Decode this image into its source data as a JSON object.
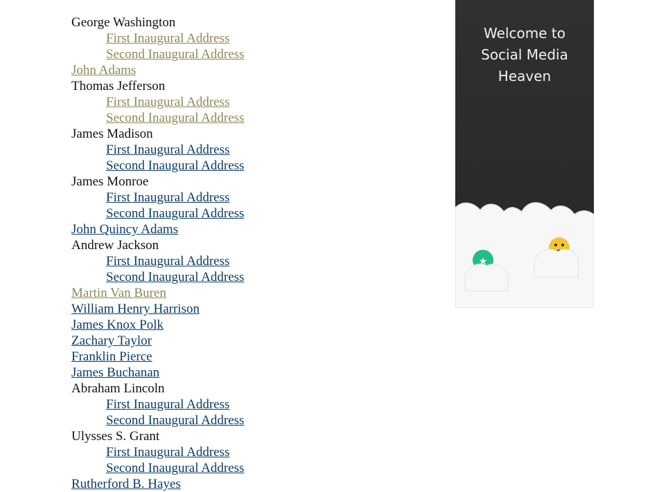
{
  "presidents": [
    {
      "name": "George Washington",
      "link": false,
      "visited": false,
      "addresses": [
        {
          "label": "First Inaugural Address",
          "visited": true
        },
        {
          "label": "Second Inaugural Address",
          "visited": true
        }
      ]
    },
    {
      "name": "John Adams",
      "link": true,
      "visited": true,
      "addresses": []
    },
    {
      "name": "Thomas Jefferson",
      "link": false,
      "visited": false,
      "addresses": [
        {
          "label": "First Inaugural Address",
          "visited": true
        },
        {
          "label": "Second Inaugural Address",
          "visited": true
        }
      ]
    },
    {
      "name": "James Madison",
      "link": false,
      "visited": false,
      "addresses": [
        {
          "label": "First Inaugural Address",
          "visited": false
        },
        {
          "label": "Second Inaugural Address",
          "visited": false
        }
      ]
    },
    {
      "name": "James Monroe",
      "link": false,
      "visited": false,
      "addresses": [
        {
          "label": "First Inaugural Address",
          "visited": false
        },
        {
          "label": "Second Inaugural Address",
          "visited": false
        }
      ]
    },
    {
      "name": "John Quincy Adams",
      "link": true,
      "visited": false,
      "addresses": []
    },
    {
      "name": "Andrew Jackson",
      "link": false,
      "visited": false,
      "addresses": [
        {
          "label": "First Inaugural Address",
          "visited": false
        },
        {
          "label": "Second Inaugural Address",
          "visited": false
        }
      ]
    },
    {
      "name": "Martin Van Buren",
      "link": true,
      "visited": true,
      "addresses": []
    },
    {
      "name": "William Henry Harrison",
      "link": true,
      "visited": false,
      "addresses": []
    },
    {
      "name": "James Knox Polk",
      "link": true,
      "visited": false,
      "addresses": []
    },
    {
      "name": "Zachary Taylor",
      "link": true,
      "visited": false,
      "addresses": []
    },
    {
      "name": "Franklin Pierce",
      "link": true,
      "visited": false,
      "addresses": []
    },
    {
      "name": "James Buchanan",
      "link": true,
      "visited": false,
      "addresses": []
    },
    {
      "name": "Abraham Lincoln",
      "link": false,
      "visited": false,
      "addresses": [
        {
          "label": "First Inaugural Address",
          "visited": false
        },
        {
          "label": "Second Inaugural Address",
          "visited": false
        }
      ]
    },
    {
      "name": "Ulysses S. Grant",
      "link": false,
      "visited": false,
      "addresses": [
        {
          "label": "First Inaugural Address",
          "visited": false
        },
        {
          "label": "Second Inaugural Address",
          "visited": false
        }
      ]
    },
    {
      "name": "Rutherford B. Hayes",
      "link": true,
      "visited": false,
      "addresses": []
    }
  ],
  "ad": {
    "title": "Welcome to\nSocial Media\nHeaven",
    "background_color": "#2d2d2d",
    "cloud_color": "#f7f7f7",
    "icons": [
      "green-emoji-icon",
      "yellow-emoji-icon"
    ]
  },
  "colors": {
    "link_unvisited": "#0b3d68",
    "link_visited": "#8c8a55",
    "text": "#111111"
  }
}
